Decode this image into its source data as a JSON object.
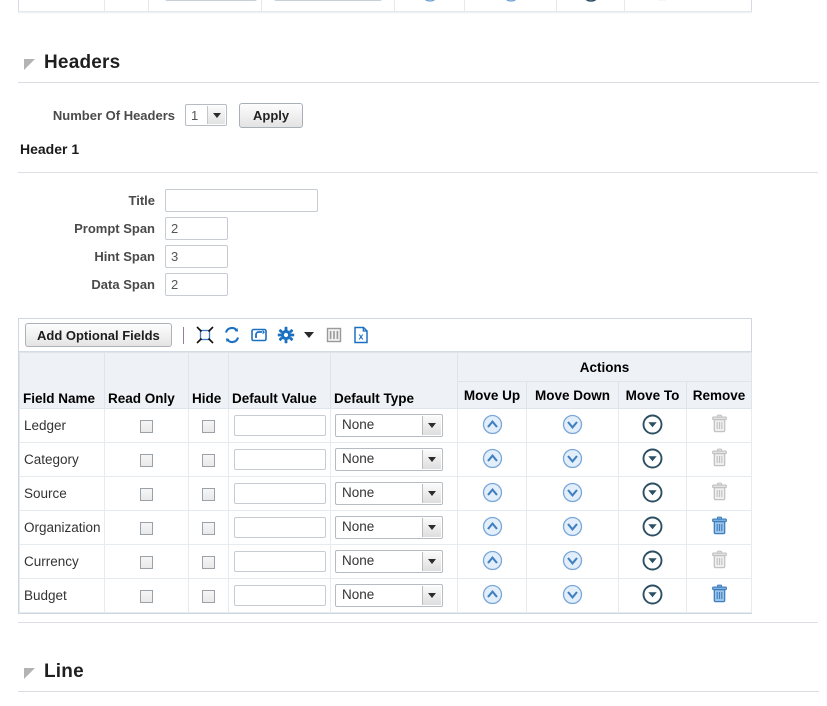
{
  "top_fragment": {
    "visible": true
  },
  "headers_section": {
    "title": "Headers",
    "number_of_headers_label": "Number Of Headers",
    "number_of_headers_value": "1",
    "apply_label": "Apply",
    "subsection_title": "Header 1",
    "fields": [
      {
        "label": "Title",
        "value": "",
        "size": "wide"
      },
      {
        "label": "Prompt Span",
        "value": "2",
        "size": "narrow"
      },
      {
        "label": "Hint Span",
        "value": "3",
        "size": "narrow"
      },
      {
        "label": "Data Span",
        "value": "2",
        "size": "narrow"
      }
    ]
  },
  "toolbar": {
    "add_optional_fields_label": "Add Optional Fields",
    "icons": [
      {
        "name": "detach-icon",
        "enabled": true
      },
      {
        "name": "refresh-icon",
        "enabled": true
      },
      {
        "name": "undo-icon",
        "enabled": true
      },
      {
        "name": "gear-icon",
        "enabled": true
      },
      {
        "name": "freeze-columns-icon",
        "enabled": false
      },
      {
        "name": "export-excel-icon",
        "enabled": true
      }
    ]
  },
  "table": {
    "columns": [
      "Field Name",
      "Read Only",
      "Hide",
      "Default Value",
      "Default Type"
    ],
    "actions_group_label": "Actions",
    "action_columns": [
      "Move Up",
      "Move Down",
      "Move To",
      "Remove"
    ],
    "default_type_options": [
      "None"
    ],
    "rows": [
      {
        "field_name": "Ledger",
        "read_only": false,
        "hide": false,
        "default_value": "",
        "default_type": "None",
        "remove_enabled": false
      },
      {
        "field_name": "Category",
        "read_only": false,
        "hide": false,
        "default_value": "",
        "default_type": "None",
        "remove_enabled": false
      },
      {
        "field_name": "Source",
        "read_only": false,
        "hide": false,
        "default_value": "",
        "default_type": "None",
        "remove_enabled": false
      },
      {
        "field_name": "Organization",
        "read_only": false,
        "hide": false,
        "default_value": "",
        "default_type": "None",
        "remove_enabled": true
      },
      {
        "field_name": "Currency",
        "read_only": false,
        "hide": false,
        "default_value": "",
        "default_type": "None",
        "remove_enabled": false
      },
      {
        "field_name": "Budget",
        "read_only": false,
        "hide": false,
        "default_value": "",
        "default_type": "None",
        "remove_enabled": true
      }
    ]
  },
  "line_section": {
    "title": "Line"
  },
  "colors": {
    "accent_blue": "#1b70c0",
    "header_bg": "#eef2f7",
    "icon_blue": "#3f7fbf",
    "icon_disabled": "#b9b9b9",
    "icon_dark_teal": "#2d4f63"
  }
}
